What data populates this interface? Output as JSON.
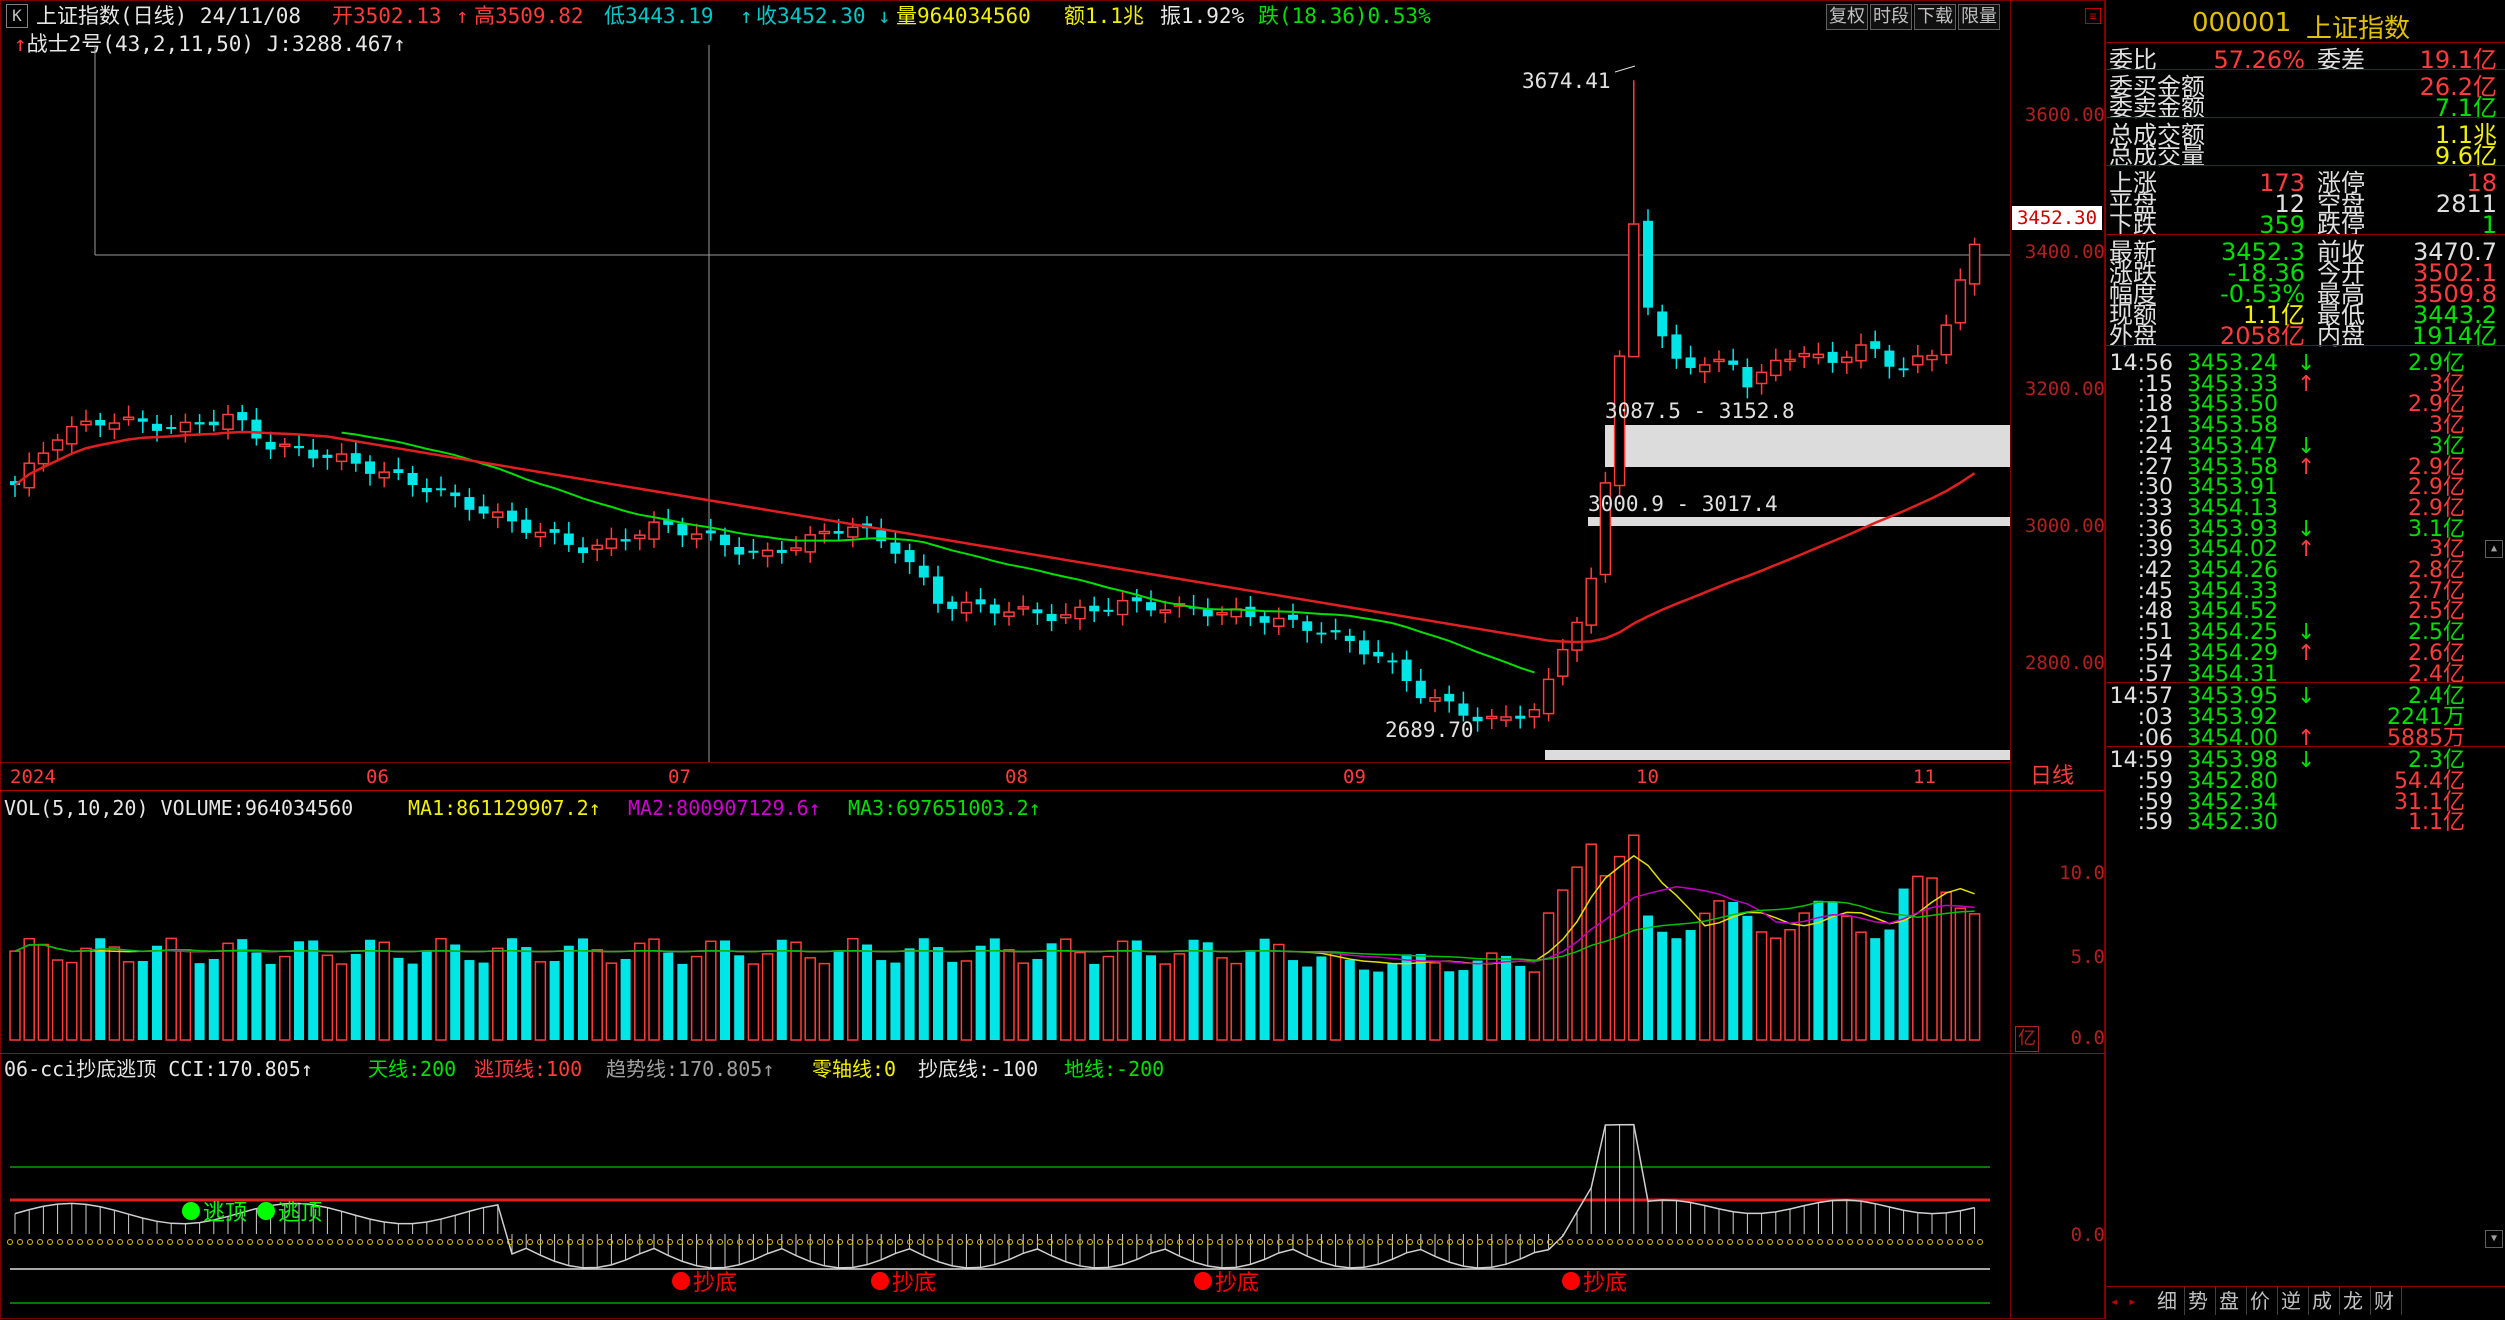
{
  "header": {
    "k_icon": "K",
    "title": "上证指数(日线) 24/11/08",
    "open": "开3502.13",
    "high": "高3509.82",
    "low": "低3443.19",
    "close": "收3452.30",
    "volume": "量964034560",
    "amount": "额1.1兆",
    "amplitude": "振1.92%",
    "change": "跌(18.36)0.53%",
    "arrow_up": "↑",
    "arrow_down": "↓",
    "buttons": [
      "复权",
      "时段",
      "下载",
      "限量"
    ],
    "indicator_line": "战士2号(43,2,11,50) J:3288.467"
  },
  "main_chart": {
    "y_labels": [
      "3600.00",
      "3400.00",
      "3200.00",
      "3000.00",
      "2800.00"
    ],
    "x_labels": [
      "2024",
      "06",
      "07",
      "08",
      "09",
      "10",
      "11"
    ],
    "period_label": "日线",
    "price_tag": "3452.30",
    "annotations": {
      "high": "3674.41",
      "low": "2689.70",
      "zone1": "3087.5 - 3152.8",
      "zone2": "3000.9 - 3017.4"
    }
  },
  "volume_chart": {
    "title": "VOL(5,10,20) VOLUME:964034560",
    "ma1": "MA1:861129907.2",
    "ma2": "MA2:800907129.6",
    "ma3": "MA3:697651003.2",
    "y_labels": [
      "10.0",
      "5.0",
      "0.0"
    ],
    "unit": "亿"
  },
  "cci_chart": {
    "title": "06-cci抄底逃顶 CCI:170.805",
    "sky": "天线:200",
    "escape": "逃顶线:100",
    "trend": "趋势线:170.805",
    "zero": "零轴线:0",
    "bottom": "抄底线:-100",
    "ground": "地线:-200",
    "y_label": "0.0",
    "signal_top": "逃顶",
    "signal_bottom": "抄底"
  },
  "right_panel": {
    "code": "000001",
    "name": "上证指数",
    "rows1": [
      {
        "l1": "委比",
        "v1": "57.26%",
        "l2": "委差",
        "v2": "19.1亿"
      }
    ],
    "rows2": [
      {
        "l": "委买金额",
        "v": "26.2亿"
      },
      {
        "l": "委卖金额",
        "v": "7.1亿"
      }
    ],
    "rows3": [
      {
        "l": "总成交额",
        "v": "1.1兆"
      },
      {
        "l": "总成交量",
        "v": "9.6亿"
      }
    ],
    "rows4": [
      {
        "l1": "上涨",
        "v1": "173",
        "l2": "涨停",
        "v2": "18"
      },
      {
        "l1": "平盘",
        "v1": "12",
        "l2": "空盘",
        "v2": "2811"
      },
      {
        "l1": "下跌",
        "v1": "359",
        "l2": "跌停",
        "v2": "1"
      }
    ],
    "rows5": [
      {
        "l1": "最新",
        "v1": "3452.3",
        "l2": "前收",
        "v2": "3470.7"
      },
      {
        "l1": "涨跌",
        "v1": "-18.36",
        "l2": "今开",
        "v2": "3502.1"
      },
      {
        "l1": "幅度",
        "v1": "-0.53%",
        "l2": "最高",
        "v2": "3509.8"
      },
      {
        "l1": "现额",
        "v1": "1.1亿",
        "l2": "最低",
        "v2": "3443.2"
      },
      {
        "l1": "外盘",
        "v1": "2058亿",
        "l2": "内盘",
        "v2": "1914亿"
      }
    ],
    "ticks": [
      {
        "t": "14:56",
        "p": "3453.24",
        "a": "↓",
        "v": "2.9亿"
      },
      {
        "t": ":15",
        "p": "3453.33",
        "a": "↑",
        "v": "3亿"
      },
      {
        "t": ":18",
        "p": "3453.50",
        "a": "",
        "v": "2.9亿"
      },
      {
        "t": ":21",
        "p": "3453.58",
        "a": "",
        "v": "3亿"
      },
      {
        "t": ":24",
        "p": "3453.47",
        "a": "↓",
        "v": "3亿"
      },
      {
        "t": ":27",
        "p": "3453.58",
        "a": "↑",
        "v": "2.9亿"
      },
      {
        "t": ":30",
        "p": "3453.91",
        "a": "",
        "v": "2.9亿"
      },
      {
        "t": ":33",
        "p": "3454.13",
        "a": "",
        "v": "2.9亿"
      },
      {
        "t": ":36",
        "p": "3453.93",
        "a": "↓",
        "v": "3.1亿"
      },
      {
        "t": ":39",
        "p": "3454.02",
        "a": "↑",
        "v": "3亿"
      },
      {
        "t": ":42",
        "p": "3454.26",
        "a": "",
        "v": "2.8亿"
      },
      {
        "t": ":45",
        "p": "3454.33",
        "a": "",
        "v": "2.7亿"
      },
      {
        "t": ":48",
        "p": "3454.52",
        "a": "",
        "v": "2.5亿"
      },
      {
        "t": ":51",
        "p": "3454.25",
        "a": "↓",
        "v": "2.5亿"
      },
      {
        "t": ":54",
        "p": "3454.29",
        "a": "↑",
        "v": "2.6亿"
      },
      {
        "t": ":57",
        "p": "3454.31",
        "a": "",
        "v": "2.4亿"
      },
      {
        "t": "14:57",
        "p": "3453.95",
        "a": "↓",
        "v": "2.4亿"
      },
      {
        "t": ":03",
        "p": "3453.92",
        "a": "",
        "v": "2241万"
      },
      {
        "t": ":06",
        "p": "3454.00",
        "a": "↑",
        "v": "5885万"
      },
      {
        "t": "14:59",
        "p": "3453.98",
        "a": "↓",
        "v": "2.3亿"
      },
      {
        "t": ":59",
        "p": "3452.80",
        "a": "",
        "v": "54.4亿"
      },
      {
        "t": ":59",
        "p": "3452.34",
        "a": "",
        "v": "31.1亿"
      },
      {
        "t": ":59",
        "p": "3452.30",
        "a": "",
        "v": "1.1亿"
      }
    ],
    "tabs": [
      "细",
      "势",
      "盘",
      "价",
      "逆",
      "成",
      "龙",
      "财"
    ]
  },
  "chart_data": {
    "type": "candlestick",
    "title": "上证指数(日线)",
    "ylim": [
      2620,
      3740
    ],
    "x_months": [
      "2024-05",
      "06",
      "07",
      "08",
      "09",
      "10",
      "11"
    ],
    "high_mark": 3674.41,
    "low_mark": 2689.7,
    "last_close": 3452.3
  },
  "colors": {
    "up": "#ff3b3b",
    "down": "#00e5e5",
    "ma_green": "#00e000",
    "ma_red": "#e02020",
    "frame": "#8b0000"
  }
}
